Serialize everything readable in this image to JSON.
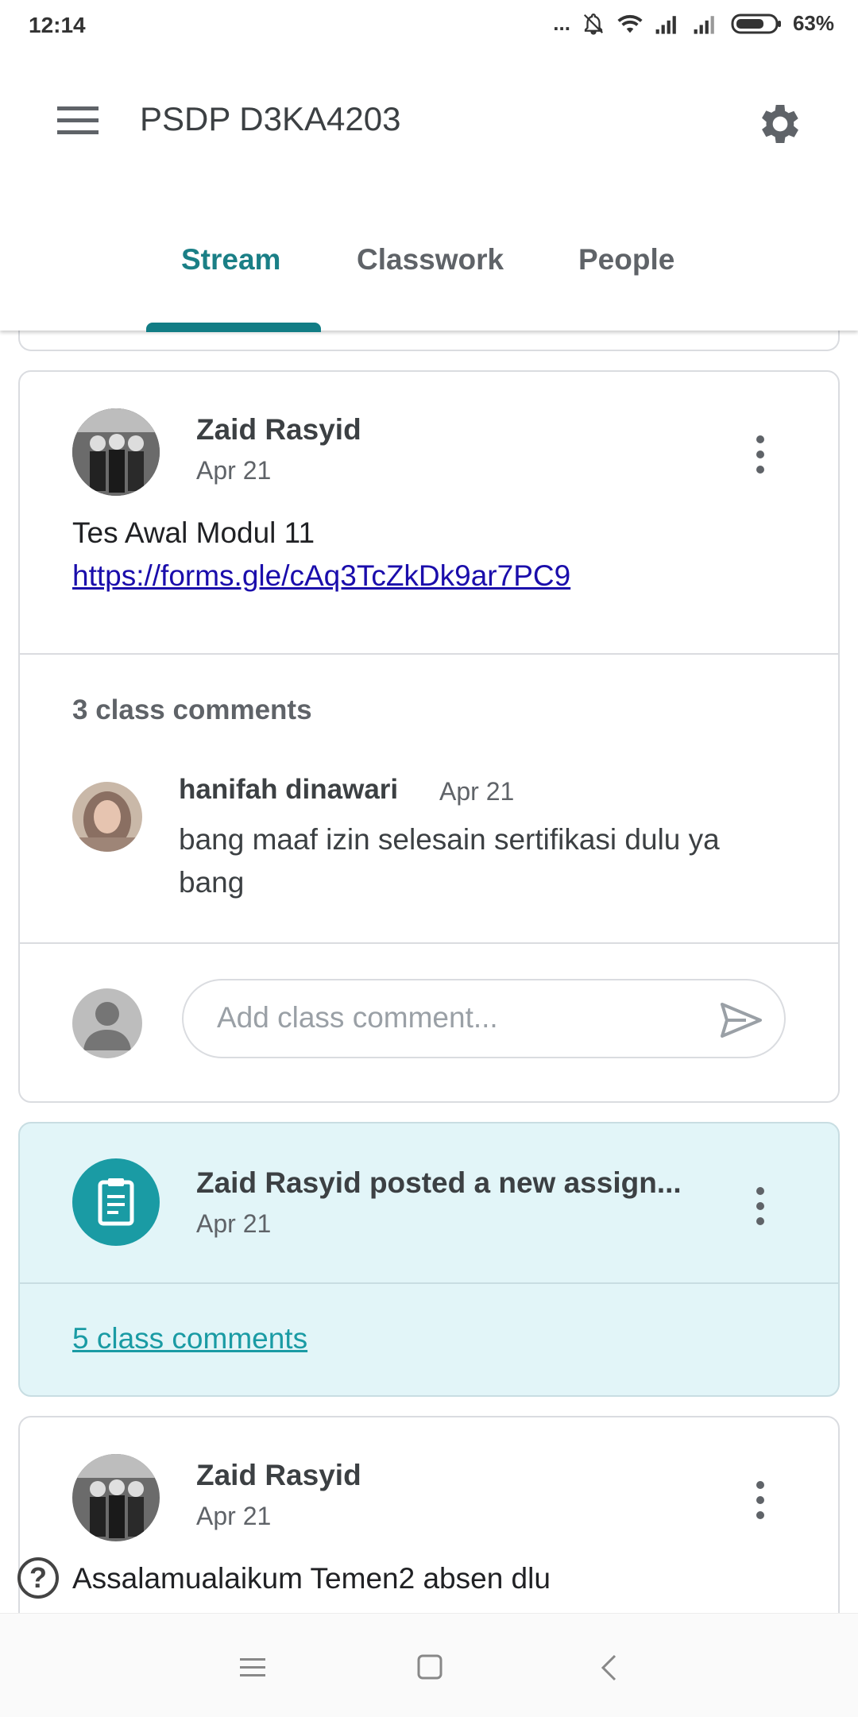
{
  "status_bar": {
    "time": "12:14",
    "dots": "...",
    "battery": "63%"
  },
  "header": {
    "title": "PSDP D3KA4203",
    "menu_icon": "menu-icon",
    "settings_icon": "gear-icon"
  },
  "tabs": [
    {
      "label": "Stream",
      "active": true
    },
    {
      "label": "Classwork",
      "active": false
    },
    {
      "label": "People",
      "active": false
    }
  ],
  "post1": {
    "author": "Zaid Rasyid",
    "date": "Apr 21",
    "text": "Tes Awal Modul 11",
    "link": "https://forms.gle/cAq3TcZkDk9ar7PC9",
    "comments_count": "3 class comments",
    "comment": {
      "author": "hanifah dinawari",
      "date": "Apr 21",
      "text": "bang maaf izin selesain sertifikasi dulu ya bang"
    },
    "add_comment_placeholder": "Add class comment..."
  },
  "assignment": {
    "title": "Zaid Rasyid posted a new assign...",
    "date": "Apr 21",
    "comments_link": "5 class comments",
    "icon": "assignment-icon"
  },
  "post2": {
    "author": "Zaid Rasyid",
    "date": "Apr 21",
    "text": "Assalamualaikum Temen2 absen dlu"
  },
  "colors": {
    "accent": "#1a7f86",
    "assignment_bg": "#e2f5f8",
    "assignment_icon": "#1a9ba4",
    "link": "#1a0dab"
  }
}
